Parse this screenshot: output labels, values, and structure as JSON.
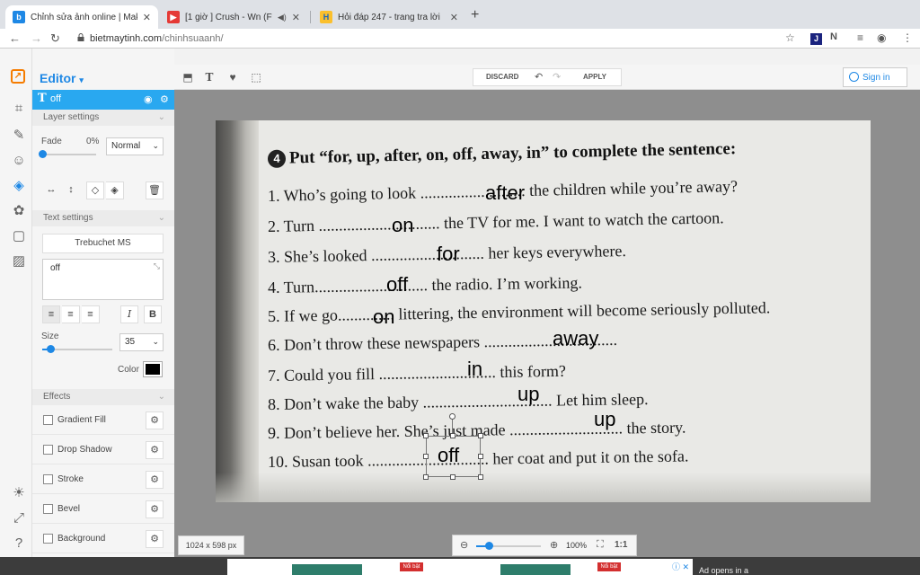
{
  "browser": {
    "tabs": [
      {
        "title": "Chỉnh sửa ảnh online | Make up",
        "active": true
      },
      {
        "title": "[1 giờ ] Crush - Wn (Ft An",
        "active": false
      },
      {
        "title": "Hỏi đáp 247 - trang tra lời",
        "active": false
      }
    ],
    "url_host": "bietmaytinh.com",
    "url_path": "/chinhsuaanh/"
  },
  "panel": {
    "editor_title": "Editor",
    "layer_name": "off",
    "layer_settings": "Layer settings",
    "fade_label": "Fade",
    "fade_value": "0%",
    "fade_fraction": 0.0,
    "blend_mode": "Normal",
    "text_settings": "Text settings",
    "font_name": "Trebuchet MS",
    "text_value": "off",
    "size_label": "Size",
    "size_value": "35",
    "size_fraction": 0.12,
    "color_label": "Color",
    "text_color": "#000000",
    "effects_label": "Effects",
    "effects": [
      "Gradient Fill",
      "Drop Shadow",
      "Stroke",
      "Bevel",
      "Background"
    ]
  },
  "toolbar": {
    "discard": "DISCARD",
    "apply": "APPLY",
    "sign_in": "Sign in"
  },
  "canvas": {
    "dimensions": "1024 x 598 px",
    "zoom": "100%",
    "actual_size": "1:1",
    "heading_num": "4",
    "heading": "Put “for, up, after, on, off, away, in” to complete the sentence:",
    "sentences": [
      "1. Who’s going to look ..........................  the children while you’re away?",
      "2. Turn .............................. the TV for me. I want to watch the cartoon.",
      "3. She’s looked ............................ her keys everywhere.",
      "4. Turn............................ the radio. I’m working.",
      "5. If we go.............. littering, the environment will become seriously polluted.",
      "6. Don’t throw these newspapers .................................",
      "7. Could you fill ............................. this form?",
      "8. Don’t wake the baby ................................  Let him sleep.",
      "9. Don’t believe her. She’s just made ............................ the story.",
      "10. Susan took .............................. her coat and put it on the sofa."
    ],
    "answers": [
      "after",
      "on",
      "for",
      "off",
      "on",
      "away",
      "in",
      "up",
      "up",
      "off"
    ]
  },
  "ad": {
    "badge": "Nổi bật",
    "text": "Ad opens in a"
  }
}
